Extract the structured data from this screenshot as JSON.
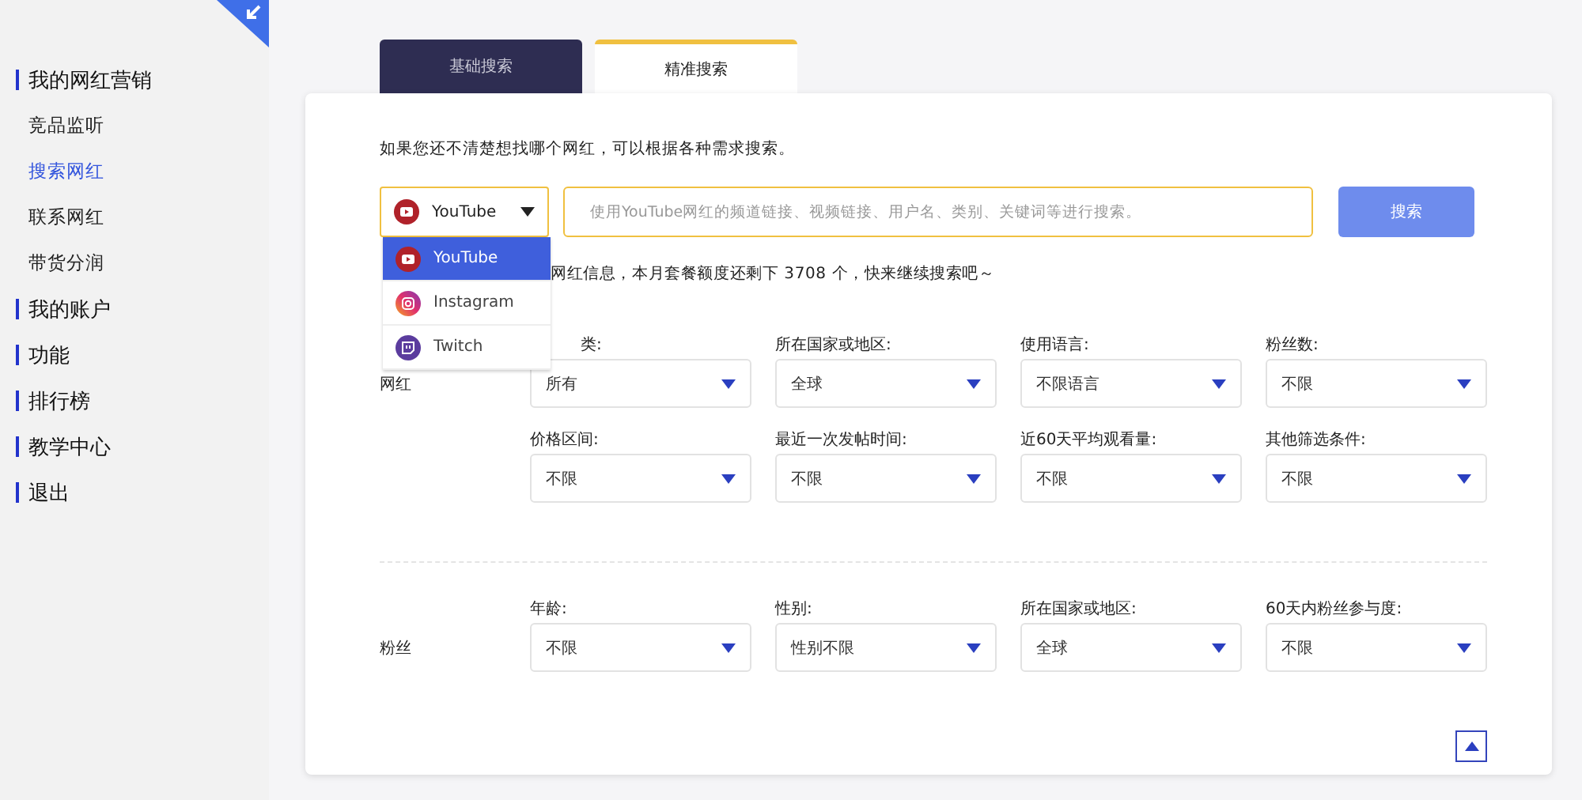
{
  "sidebar": {
    "sections": [
      {
        "label": "我的网红营销",
        "children": [
          {
            "label": "竞品监听",
            "selected": false
          },
          {
            "label": "搜索网红",
            "selected": true
          },
          {
            "label": "联系网红",
            "selected": false
          },
          {
            "label": "带货分润",
            "selected": false
          }
        ]
      },
      {
        "label": "我的账户"
      },
      {
        "label": "功能"
      },
      {
        "label": "排行榜"
      },
      {
        "label": "教学中心"
      },
      {
        "label": "退出"
      }
    ]
  },
  "tabs": [
    {
      "label": "基础搜索",
      "selected": false
    },
    {
      "label": "精准搜索",
      "selected": true
    }
  ],
  "intro": "如果您还不清楚想找哪个网红，可以根据各种需求搜索。",
  "platform_select": {
    "value": "YouTube",
    "expanded": true,
    "options": [
      {
        "label": "YouTube",
        "kind": "youtube",
        "selected": true
      },
      {
        "label": "Instagram",
        "kind": "instagram",
        "selected": false
      },
      {
        "label": "Twitch",
        "kind": "twitch",
        "selected": false
      }
    ]
  },
  "search": {
    "placeholder": "使用YouTube网红的频道链接、视频链接、用户名、类别、关键词等进行搜索。"
  },
  "search_button": "搜索",
  "quota": "网红信息，本月套餐额度还剩下 3708 个，快来继续搜索吧～",
  "filter_groups": [
    {
      "label": "网红",
      "rows": [
        [
          {
            "label": "类:",
            "value": "所有"
          },
          {
            "label": "所在国家或地区:",
            "value": "全球"
          },
          {
            "label": "使用语言:",
            "value": "不限语言"
          },
          {
            "label": "粉丝数:",
            "value": "不限"
          }
        ],
        [
          {
            "label": "价格区间:",
            "value": "不限"
          },
          {
            "label": "最近一次发帖时间:",
            "value": "不限"
          },
          {
            "label": "近60天平均观看量:",
            "value": "不限"
          },
          {
            "label": "其他筛选条件:",
            "value": "不限"
          }
        ]
      ]
    },
    {
      "label": "粉丝",
      "rows": [
        [
          {
            "label": "年龄:",
            "value": "不限"
          },
          {
            "label": "性别:",
            "value": "性别不限"
          },
          {
            "label": "所在国家或地区:",
            "value": "全球"
          },
          {
            "label": "60天内粉丝参与度:",
            "value": "不限"
          }
        ]
      ]
    }
  ]
}
